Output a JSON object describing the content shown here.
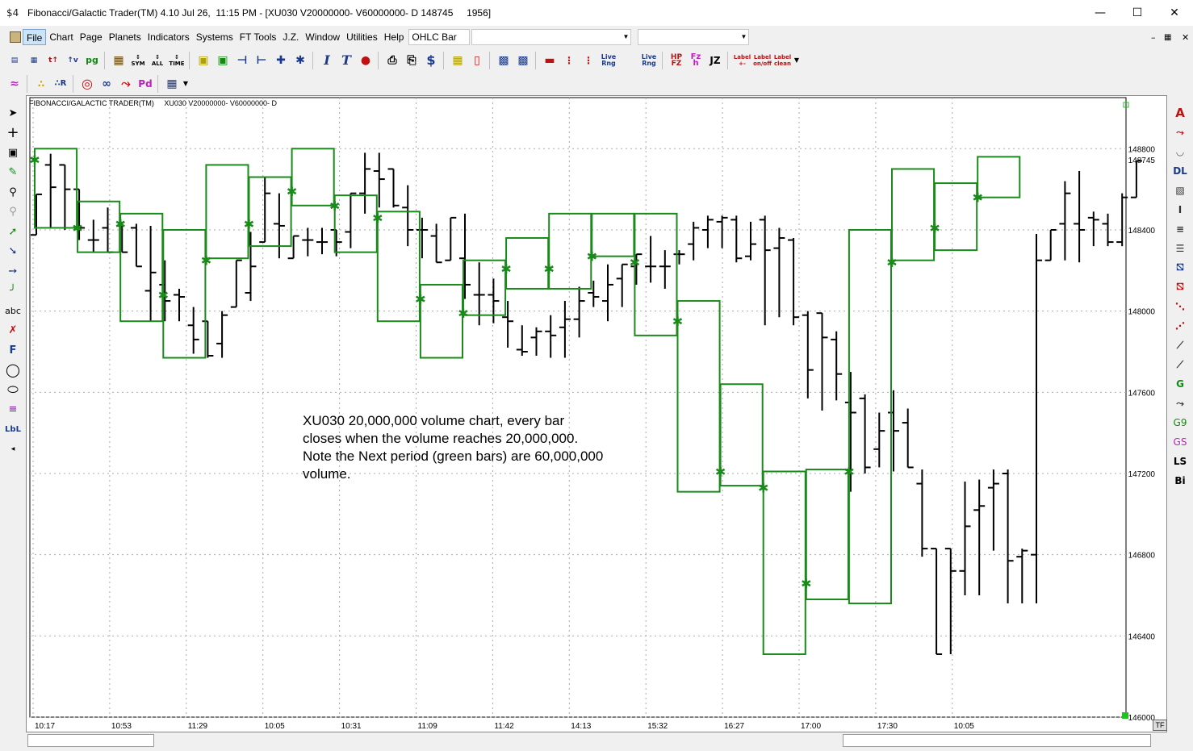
{
  "window": {
    "title": "Fibonacci/Galactic Trader(TM) 4.10 Jul 26,  11:15 PM - [XU030 V20000000- V60000000- D 148745     1956]",
    "app_icon": "$4"
  },
  "menu": {
    "items": [
      "File",
      "Chart",
      "Page",
      "Planets",
      "Indicators",
      "Systems",
      "FT Tools",
      "J.Z.",
      "Window",
      "Utilities",
      "Help"
    ],
    "chart_type_select": "OHLC Bar",
    "combo2": "",
    "combo3": ""
  },
  "toolbar1": [
    "doc",
    "bars",
    "tick",
    "vol",
    "pg",
    "grid",
    "SYM",
    "ALL",
    "TIME",
    "cube",
    "cube2",
    "arr1",
    "arr2",
    "arr3",
    "arr4",
    "T",
    "T",
    "signal",
    "print",
    "copy",
    "$",
    "stack",
    "cndl",
    "bars2",
    "bars3",
    "red",
    "dots",
    "Live Rng",
    "Live Rng",
    "HP FZ",
    "Fz h",
    "JZ",
    "Label +-",
    "Label on/off",
    "Label clean"
  ],
  "toolbar2": [
    "wave",
    "dots",
    "R",
    "circle",
    "spiral",
    "fan",
    "Pd",
    "grid"
  ],
  "left_tools": [
    "cursor-icon",
    "crosshair-icon",
    "magnet-icon",
    "pencil-icon",
    "zoom-in-icon",
    "zoom-out-icon",
    "line-icon",
    "line2-icon",
    "line3-icon",
    "line4-icon",
    "abc",
    "x-icon",
    "F",
    "circle-icon",
    "ellipse-icon",
    "lines-icon",
    "LbL"
  ],
  "left_tool_labels": {
    "abc": "abc",
    "F": "F",
    "LbL": "LbL"
  },
  "right_tools": [
    "A",
    "fan",
    "arc",
    "DL",
    "grid",
    "I",
    "lines",
    "stack",
    "bars",
    "bars-red",
    "dots",
    "dots2",
    "slash",
    "slash2",
    "G",
    "fan2",
    "G9",
    "GS",
    "LS",
    "Bi"
  ],
  "right_tool_labels": {
    "A": "A",
    "DL": "DL",
    "I": "I",
    "G": "G",
    "G9": "G9",
    "GS": "GS",
    "LS": "LS",
    "Bi": "Bi"
  },
  "chart_header": {
    "program": "FIBONACCI/GALACTIC TRADER(TM)",
    "symbol": "XU030 V20000000- V60000000- D"
  },
  "annotation": "XU030 20,000,000 volume chart, every bar\ncloses when the volume reaches 20,000,000.\nNote the Next period (green bars) are 60,000,000\nvolume.",
  "tf_badge": "TF",
  "colors": {
    "bar": "#000000",
    "next_period": "#1a8a1a",
    "grid": "#aaaaaa",
    "background": "#ffffff"
  },
  "chart_data": {
    "type": "ohlc",
    "ylim": [
      146000,
      148980
    ],
    "yticks": [
      148800,
      148400,
      148000,
      147600,
      147200,
      146800,
      146400,
      146000
    ],
    "current_price_label": "148745",
    "xticks": [
      "10:17",
      "10:53",
      "11:29",
      "10:05",
      "10:31",
      "11:09",
      "11:42",
      "14:13",
      "15:32",
      "16:27",
      "17:00",
      "17:30",
      "10:05"
    ],
    "bars": [
      {
        "o": 148375,
        "h": 148575,
        "l": 148375,
        "c": 148575
      },
      {
        "o": 148720,
        "h": 148775,
        "l": 148410,
        "c": 148610
      },
      {
        "o": 148720,
        "h": 148650,
        "l": 148400,
        "c": 148600
      },
      {
        "o": 148600,
        "h": 148600,
        "l": 148350,
        "c": 148410
      },
      {
        "o": 148350,
        "h": 148450,
        "l": 148290,
        "c": 148350
      },
      {
        "o": 148410,
        "h": 148510,
        "l": 148290,
        "c": 148290
      },
      {
        "o": 148420,
        "h": 148440,
        "l": 148290,
        "c": 148290
      },
      {
        "o": 148410,
        "h": 148430,
        "l": 148270,
        "c": 148220
      },
      {
        "o": 148100,
        "h": 148420,
        "l": 147950,
        "c": 148190
      },
      {
        "o": 148130,
        "h": 148250,
        "l": 147950,
        "c": 148050
      },
      {
        "o": 148080,
        "h": 148110,
        "l": 147950,
        "c": 148070
      },
      {
        "o": 147930,
        "h": 148020,
        "l": 147790,
        "c": 147860
      },
      {
        "o": 147950,
        "h": 147950,
        "l": 147770,
        "c": 147780
      },
      {
        "o": 147840,
        "h": 148000,
        "l": 147770,
        "c": 147980
      },
      {
        "o": 148020,
        "h": 148250,
        "l": 148020,
        "c": 148250
      },
      {
        "o": 148090,
        "h": 148390,
        "l": 148050,
        "c": 148220
      },
      {
        "o": 148340,
        "h": 148660,
        "l": 148340,
        "c": 148580
      },
      {
        "o": 148430,
        "h": 148580,
        "l": 148260,
        "c": 148420
      },
      {
        "o": 148260,
        "h": 148370,
        "l": 148260,
        "c": 148370
      },
      {
        "o": 148350,
        "h": 148410,
        "l": 148270,
        "c": 148350
      },
      {
        "o": 148340,
        "h": 148410,
        "l": 148280,
        "c": 148340
      },
      {
        "o": 148400,
        "h": 148400,
        "l": 148270,
        "c": 148340
      },
      {
        "o": 148390,
        "h": 148580,
        "l": 148310,
        "c": 148580
      },
      {
        "o": 148580,
        "h": 148780,
        "l": 148480,
        "c": 148700
      },
      {
        "o": 148690,
        "h": 148780,
        "l": 148510,
        "c": 148650
      },
      {
        "o": 148700,
        "h": 148660,
        "l": 148510,
        "c": 148520
      },
      {
        "o": 148510,
        "h": 148620,
        "l": 148320,
        "c": 148400
      },
      {
        "o": 148400,
        "h": 148460,
        "l": 148260,
        "c": 148400
      },
      {
        "o": 148370,
        "h": 148430,
        "l": 148240,
        "c": 148240
      },
      {
        "o": 148250,
        "h": 148460,
        "l": 148300,
        "c": 148460
      },
      {
        "o": 148260,
        "h": 148480,
        "l": 148060,
        "c": 148130
      },
      {
        "o": 148080,
        "h": 148240,
        "l": 147930,
        "c": 148080
      },
      {
        "o": 148080,
        "h": 148160,
        "l": 147940,
        "c": 148050
      },
      {
        "o": 147970,
        "h": 148050,
        "l": 147820,
        "c": 147950
      },
      {
        "o": 147810,
        "h": 147930,
        "l": 147780,
        "c": 147800
      },
      {
        "o": 147870,
        "h": 147920,
        "l": 147780,
        "c": 147900
      },
      {
        "o": 147900,
        "h": 147980,
        "l": 147770,
        "c": 147880
      },
      {
        "o": 147920,
        "h": 148050,
        "l": 147770,
        "c": 147960
      },
      {
        "o": 147960,
        "h": 148120,
        "l": 147870,
        "c": 148050
      },
      {
        "o": 148090,
        "h": 148150,
        "l": 148020,
        "c": 148070
      },
      {
        "o": 148050,
        "h": 148230,
        "l": 147950,
        "c": 148130
      },
      {
        "o": 148160,
        "h": 148220,
        "l": 148020,
        "c": 148230
      },
      {
        "o": 148220,
        "h": 148280,
        "l": 148130,
        "c": 148280
      },
      {
        "o": 148220,
        "h": 148370,
        "l": 148140,
        "c": 148220
      },
      {
        "o": 148220,
        "h": 148300,
        "l": 148110,
        "c": 148220
      },
      {
        "o": 148280,
        "h": 148300,
        "l": 148230,
        "c": 148280
      },
      {
        "o": 148330,
        "h": 148440,
        "l": 148250,
        "c": 148410
      },
      {
        "o": 148400,
        "h": 148470,
        "l": 148310,
        "c": 148450
      },
      {
        "o": 148440,
        "h": 148470,
        "l": 148310,
        "c": 148460
      },
      {
        "o": 148450,
        "h": 148470,
        "l": 148240,
        "c": 148260
      },
      {
        "o": 148270,
        "h": 148440,
        "l": 148250,
        "c": 148330
      },
      {
        "o": 148450,
        "h": 148470,
        "l": 147930,
        "c": 148300
      },
      {
        "o": 148310,
        "h": 148410,
        "l": 147970,
        "c": 148360
      },
      {
        "o": 148350,
        "h": 148360,
        "l": 147930,
        "c": 147970
      },
      {
        "o": 147980,
        "h": 148000,
        "l": 147570,
        "c": 147710
      },
      {
        "o": 147990,
        "h": 147990,
        "l": 147510,
        "c": 147870
      },
      {
        "o": 147860,
        "h": 147900,
        "l": 147560,
        "c": 147690
      },
      {
        "o": 147550,
        "h": 147700,
        "l": 147110,
        "c": 147500
      },
      {
        "o": 147570,
        "h": 147590,
        "l": 147200,
        "c": 147230
      },
      {
        "o": 147320,
        "h": 147500,
        "l": 147230,
        "c": 147410
      },
      {
        "o": 147500,
        "h": 147610,
        "l": 147210,
        "c": 147410
      },
      {
        "o": 147450,
        "h": 147520,
        "l": 147230,
        "c": 147230
      },
      {
        "o": 147150,
        "h": 147220,
        "l": 146790,
        "c": 146830
      },
      {
        "o": 146830,
        "h": 146830,
        "l": 146310,
        "c": 146310
      },
      {
        "o": 146830,
        "h": 146830,
        "l": 146310,
        "c": 146720
      },
      {
        "o": 146720,
        "h": 147160,
        "l": 146600,
        "c": 146940
      },
      {
        "o": 147020,
        "h": 147170,
        "l": 146600,
        "c": 147040
      },
      {
        "o": 147130,
        "h": 147220,
        "l": 146820,
        "c": 147150
      },
      {
        "o": 147200,
        "h": 147220,
        "l": 146560,
        "c": 146770
      },
      {
        "o": 146790,
        "h": 146830,
        "l": 146560,
        "c": 146820
      },
      {
        "o": 146800,
        "h": 148380,
        "l": 146560,
        "c": 148250
      },
      {
        "o": 148250,
        "h": 148330,
        "l": 148260,
        "c": 148400
      },
      {
        "o": 148430,
        "h": 148640,
        "l": 148250,
        "c": 148580
      },
      {
        "o": 148430,
        "h": 148690,
        "l": 148240,
        "c": 148400
      },
      {
        "o": 148460,
        "h": 148490,
        "l": 148320,
        "c": 148450
      },
      {
        "o": 148430,
        "h": 148480,
        "l": 148320,
        "c": 148340
      },
      {
        "o": 148340,
        "h": 148580,
        "l": 148320,
        "c": 148560
      },
      {
        "o": 148560,
        "h": 148740,
        "l": 148560,
        "c": 148740
      }
    ],
    "next_period_boxes": [
      {
        "h": 148800,
        "l": 148410,
        "dot": 148745
      },
      {
        "h": 148540,
        "l": 148290,
        "dot": 148410
      },
      {
        "h": 148480,
        "l": 147950,
        "dot": 148430
      },
      {
        "h": 148400,
        "l": 147770,
        "dot": 148080
      },
      {
        "h": 148720,
        "l": 148260,
        "dot": 148250
      },
      {
        "h": 148660,
        "l": 148320,
        "dot": 148430
      },
      {
        "h": 148800,
        "l": 148520,
        "dot": 148590
      },
      {
        "h": 148570,
        "l": 148290,
        "dot": 148520
      },
      {
        "h": 148490,
        "l": 147950,
        "dot": 148460
      },
      {
        "h": 148130,
        "l": 147770,
        "dot": 148060
      },
      {
        "h": 148250,
        "l": 147980,
        "dot": 147990
      },
      {
        "h": 148360,
        "l": 148110,
        "dot": 148210
      },
      {
        "h": 148480,
        "l": 148110,
        "dot": 148210
      },
      {
        "h": 148480,
        "l": 148270,
        "dot": 148270
      },
      {
        "h": 148480,
        "l": 147880,
        "dot": 148240
      },
      {
        "h": 148050,
        "l": 147110,
        "dot": 147950
      },
      {
        "h": 147640,
        "l": 147140,
        "dot": 147210
      },
      {
        "h": 147210,
        "l": 146310,
        "dot": 147130
      },
      {
        "h": 147220,
        "l": 146580,
        "dot": 146660
      },
      {
        "h": 148400,
        "l": 146560,
        "dot": 147210
      },
      {
        "h": 148700,
        "l": 148250,
        "dot": 148240
      },
      {
        "h": 148630,
        "l": 148300,
        "dot": 148410
      },
      {
        "h": 148760,
        "l": 148560,
        "dot": 148560
      }
    ]
  }
}
